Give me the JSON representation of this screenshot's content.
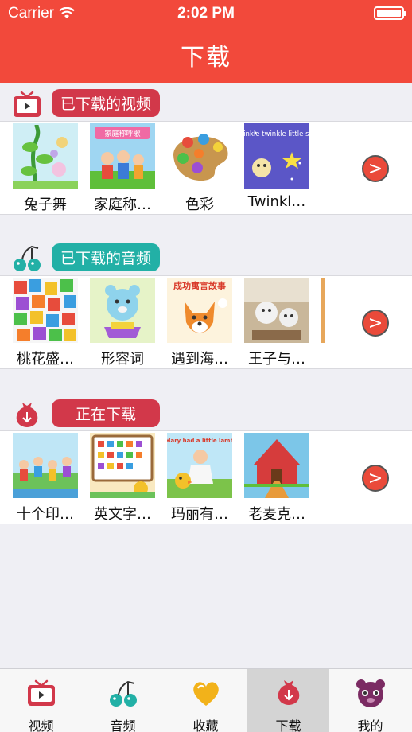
{
  "status": {
    "carrier": "Carrier",
    "time": "2:02 PM"
  },
  "nav": {
    "title": "下载"
  },
  "sections": [
    {
      "title": "已下载的视频",
      "pill_color": "#d2384a",
      "icon": "tv-icon",
      "items": [
        "兔子舞",
        "家庭称…",
        "色彩",
        "Twinkl…"
      ],
      "thumb_texts": [
        "",
        "家庭称呼歌",
        "",
        "Twinkle twinkle little star"
      ]
    },
    {
      "title": "已下载的音频",
      "pill_color": "#22b0a6",
      "icon": "music-note-icon",
      "items": [
        "桃花盛…",
        "形容词",
        "遇到海…",
        "王子与…"
      ],
      "thumb_texts": [
        "",
        "",
        "成功寓言故事",
        ""
      ]
    },
    {
      "title": "正在下载",
      "pill_color": "#d2384a",
      "icon": "download-bag-icon",
      "items": [
        "十个印…",
        "英文字…",
        "玛丽有…",
        "老麦克…"
      ],
      "thumb_texts": [
        "",
        "",
        "Mary had a little lamb",
        ""
      ]
    }
  ],
  "more_label": ">",
  "tabs": [
    {
      "label": "视频",
      "icon": "tv-icon"
    },
    {
      "label": "音频",
      "icon": "music-note-icon"
    },
    {
      "label": "收藏",
      "icon": "heart-icon"
    },
    {
      "label": "下载",
      "icon": "download-bag-icon",
      "active": true
    },
    {
      "label": "我的",
      "icon": "bear-icon"
    }
  ],
  "colors": {
    "accent": "#f2493b",
    "red": "#d2384a",
    "teal": "#22b0a6",
    "yellow": "#f2b21a",
    "purple": "#7b2b63"
  }
}
